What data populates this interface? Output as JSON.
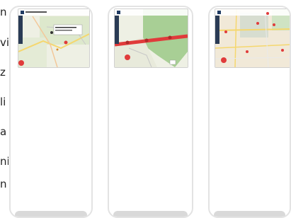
{
  "page_text": {
    "line_letters": [
      "n",
      "vi",
      "z",
      "li",
      "a",
      "ni",
      "n"
    ]
  },
  "cards": [
    {
      "id": "card-1",
      "map_style": "satellite-light"
    },
    {
      "id": "card-2",
      "map_style": "forest-route"
    },
    {
      "id": "card-3",
      "map_style": "dense-city"
    }
  ],
  "colors": {
    "route_red": "#e03b3b",
    "map_green": "#cfe3c3",
    "forest_green": "#a8cf95",
    "card_border": "#e3e3e3"
  }
}
